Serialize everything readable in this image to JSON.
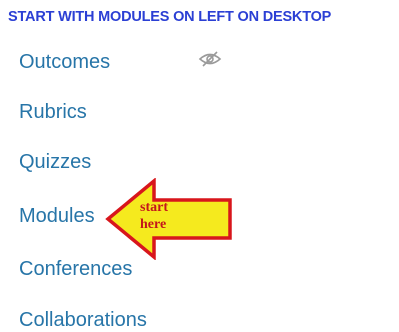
{
  "banner": {
    "text": "START WITH MODULES ON LEFT ON DESKTOP",
    "color": "#2b3fd4"
  },
  "nav": {
    "link_color": "#2775a8",
    "items": [
      {
        "label": "Outcomes",
        "hidden": true
      },
      {
        "label": "Rubrics"
      },
      {
        "label": "Quizzes"
      },
      {
        "label": "Modules"
      },
      {
        "label": "Conferences"
      },
      {
        "label": "Collaborations"
      }
    ],
    "hidden_icon": "eye-slash-icon"
  },
  "callout": {
    "line1": "start",
    "line2": "here",
    "fill_color": "#f5ea1e",
    "outline_color": "#d8161c",
    "text_color": "#c4161c"
  }
}
